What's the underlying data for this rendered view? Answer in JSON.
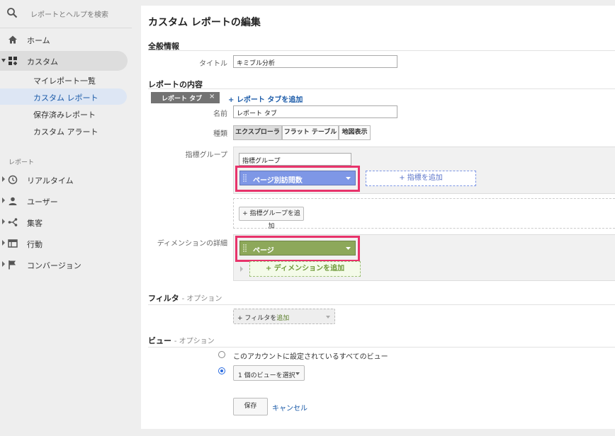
{
  "sidebar": {
    "search_placeholder": "レポートとヘルプを検索",
    "home": "ホーム",
    "custom": "カスタム",
    "sub_items": [
      "マイレポート一覧",
      "カスタム レポート",
      "保存済みレポート",
      "カスタム アラート"
    ],
    "reports_section": "レポート",
    "report_items": [
      "リアルタイム",
      "ユーザー",
      "集客",
      "行動",
      "コンバージョン"
    ]
  },
  "main": {
    "title": "カスタム レポートの編集",
    "general": {
      "heading": "全般情報",
      "title_label": "タイトル",
      "title_value": "キミブル分析"
    },
    "content": {
      "heading": "レポートの内容",
      "tab_chip": "レポート タブ",
      "tab_close": "×",
      "add_tab": "+ レポート タブを追加",
      "name_label": "名前",
      "name_value": "レポート タブ",
      "type_label": "種類",
      "types": [
        "エクスプローラ",
        "フラット テーブル",
        "地図表示"
      ],
      "metric_group_label": "指標グループ",
      "metric_group_name": "指標グループ",
      "metric_pill": "ページ別訪問数",
      "add_metric": "+ 指標を追加",
      "add_metric_group": "+ 指標グループを追加",
      "dimension_label": "ディメンションの詳細",
      "dimension_pill": "ページ",
      "add_dimension": "+ ディメンションを追加"
    },
    "filter": {
      "heading": "フィルタ",
      "optional": "- オプション",
      "add_filter_prefix": "+ フィルタを",
      "add_filter_suffix": "追加"
    },
    "view": {
      "heading": "ビュー",
      "optional": "- オプション",
      "option_all": "このアカウントに設定されているすべてのビュー",
      "option_select": "1 個のビューを選択"
    },
    "actions": {
      "save": "保存",
      "cancel": "キャンセル"
    }
  },
  "colors": {
    "metric_pill": "#7e97e6",
    "dimension_pill": "#8da85a",
    "highlight": "#e8336b",
    "link": "#1a5aa8"
  }
}
